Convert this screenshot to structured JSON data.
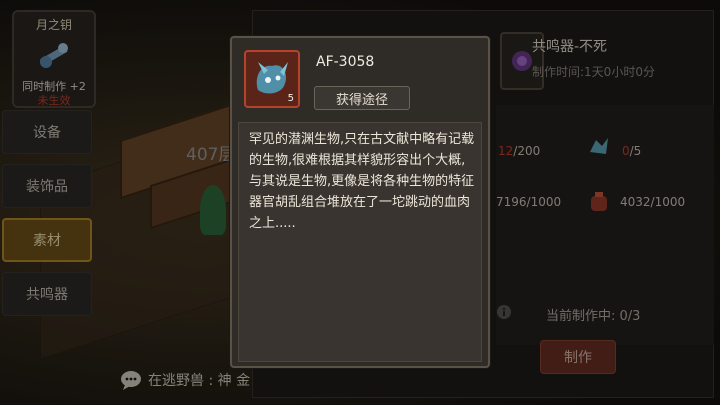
{
  "card": {
    "title": "月之钥",
    "line1": "同时制作 +2",
    "line2": "未生效"
  },
  "menu": [
    {
      "label": "设备",
      "active": false
    },
    {
      "label": "装饰品",
      "active": false
    },
    {
      "label": "素材",
      "active": true
    },
    {
      "label": "共鸣器",
      "active": false
    }
  ],
  "scene": {
    "floor_label": "407层"
  },
  "chat": {
    "text": "在逃野兽 : 神 金"
  },
  "craft": {
    "title": "共鸣器-不死",
    "time": "制作时间:1天0小时0分",
    "req1_have": "12",
    "req1_need": "/200",
    "req2_have": "0",
    "req2_need": "/5",
    "req3": "7196/1000",
    "req4": "4032/1000",
    "pending_label": "当前制作中: ",
    "pending_val": "0/3",
    "make_button": "制作"
  },
  "popup": {
    "name": "AF-3058",
    "count": "5",
    "source_button": "获得途径",
    "description": "罕见的潜渊生物,只在古文献中略有记载的生物,很难根据其样貌形容出个大概,与其说是生物,更像是将各种生物的特征器官胡乱组合堆放在了一坨跳动的血肉之上....."
  },
  "colors": {
    "accent": "#b58a2a",
    "warning": "#c9402c",
    "panel": "#2f2c28"
  }
}
